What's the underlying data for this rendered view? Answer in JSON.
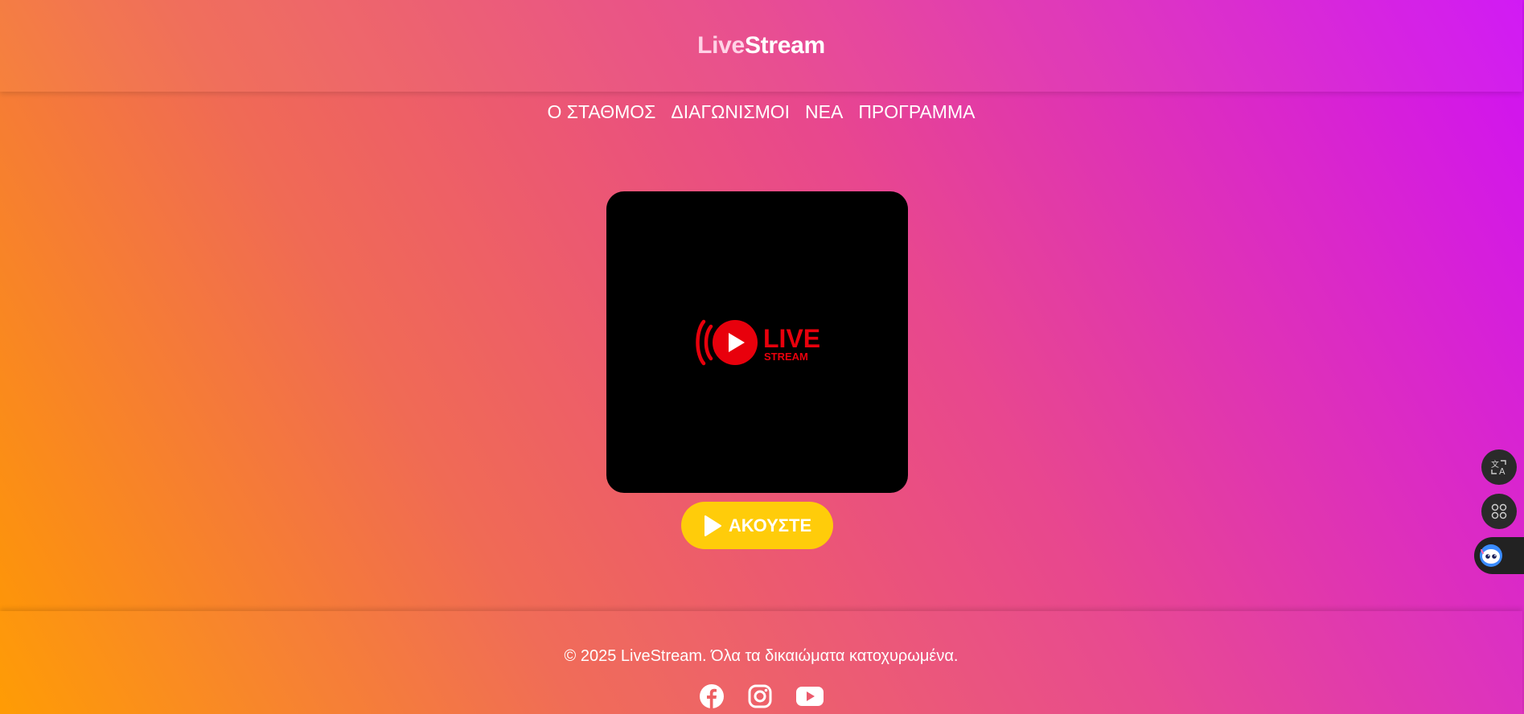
{
  "header": {
    "logo_part1": "Live",
    "logo_part2": "Stream"
  },
  "nav": {
    "items": [
      {
        "label": "Ο ΣΤΑΘΜΟΣ"
      },
      {
        "label": "ΔΙΑΓΩΝΙΣΜΟΙ"
      },
      {
        "label": "ΝΕΑ"
      },
      {
        "label": "ΠΡΟΓΡΑΜΜΑ"
      }
    ]
  },
  "player": {
    "logo_word1": "LIVE",
    "logo_word2": "STREAM",
    "logo_color": "#e8000c"
  },
  "listen_button": {
    "label": "ΑΚΟΥΣΤΕ",
    "icon": "play-icon",
    "color": "#ffcc0a"
  },
  "footer": {
    "copyright": "© 2025 LiveStream. Όλα τα δικαιώματα κατοχυρωμένα.",
    "social": [
      "facebook-icon",
      "instagram-icon",
      "youtube-icon"
    ]
  },
  "side_widgets": [
    "translate-icon",
    "apps-grid-icon",
    "assistant-avatar-icon"
  ],
  "colors": {
    "gradient_start": "#ff9a00",
    "gradient_end": "#d011f5"
  }
}
